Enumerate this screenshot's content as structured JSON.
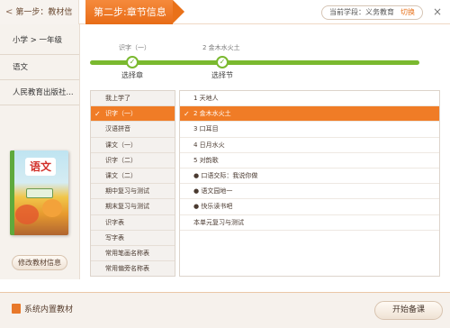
{
  "header": {
    "step1_label": "第一步：教材信息",
    "step1_arrow": "<",
    "step2_label": "第二步:章节信息",
    "school_label": "当前学段：义务教育",
    "switch_label": "切换",
    "close_glyph": "×"
  },
  "sidebar": {
    "items": [
      {
        "label": "小学 > 一年级"
      },
      {
        "label": "语文"
      },
      {
        "label": "人民教育出版社..."
      }
    ],
    "book_title": "语文",
    "modify_button": "修改教材信息"
  },
  "progress": {
    "steps": [
      {
        "value": "识字（一）",
        "label": "选择章",
        "icon": "check-icon"
      },
      {
        "value": "2 金木水火土",
        "label": "选择节",
        "icon": "check-icon"
      }
    ],
    "check_glyph": "✓",
    "track_color": "#7ab92f"
  },
  "chapters": {
    "items": [
      {
        "label": "我上学了"
      },
      {
        "label": "识字（一）",
        "active": true
      },
      {
        "label": "汉语拼音"
      },
      {
        "label": "课文（一）"
      },
      {
        "label": "识字（二）"
      },
      {
        "label": "课文（二）"
      },
      {
        "label": "期中复习与测试"
      },
      {
        "label": "期末复习与测试"
      },
      {
        "label": "识字表"
      },
      {
        "label": "写字表"
      },
      {
        "label": "常用笔画名称表"
      },
      {
        "label": "常用偏旁名称表"
      }
    ],
    "check_glyph": "✓"
  },
  "sections": {
    "items": [
      {
        "label": "1 天地人"
      },
      {
        "label": "2 金木水火土",
        "active": true
      },
      {
        "label": "3 口耳目"
      },
      {
        "label": "4 日月水火"
      },
      {
        "label": "5 对韵歌"
      },
      {
        "label": "● 口语交际：我说你做"
      },
      {
        "label": "● 语文园地一"
      },
      {
        "label": "● 快乐读书吧"
      },
      {
        "label": "本单元复习与测试"
      }
    ],
    "check_glyph": "✓"
  },
  "footer": {
    "tag_label": "系统内置教材",
    "start_button": "开始备课"
  },
  "colors": {
    "accent": "#f07c26",
    "progress": "#7ab92f",
    "sidebar_bg": "#f6f2ed"
  }
}
